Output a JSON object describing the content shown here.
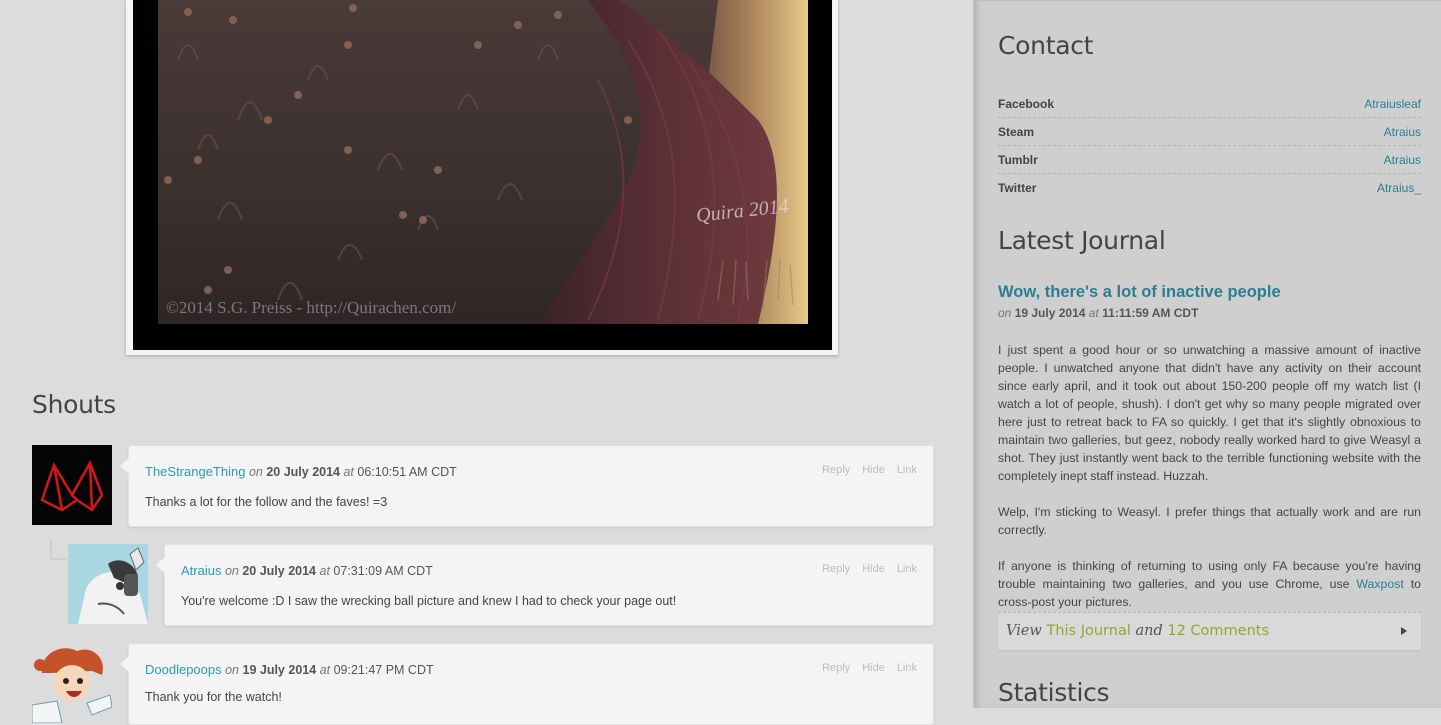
{
  "artwork": {
    "watermark": "©2014 S.G. Preiss - http://Quirachen.com/",
    "signature": "Quira 2014"
  },
  "shouts": {
    "title": "Shouts",
    "items": [
      {
        "user": "TheStrangeThing",
        "on_word": "on",
        "date": "20 July 2014",
        "at_word": "at",
        "time": "06:10:51 AM CDT",
        "message": "Thanks a lot for the follow and the faves! =3",
        "actions": [
          "Reply",
          "Hide",
          "Link"
        ],
        "avatar": "red-wire-shape-avatar"
      },
      {
        "user": "Atraius",
        "on_word": "on",
        "date": "20 July 2014",
        "at_word": "at",
        "time": "07:31:09 AM CDT",
        "message": "You're welcome :D I saw the wrecking ball picture and knew I had to check your page out!",
        "actions": [
          "Reply",
          "Hide",
          "Link"
        ],
        "avatar": "husky-character-avatar"
      },
      {
        "user": "Doodlepoops",
        "on_word": "on",
        "date": "19 July 2014",
        "at_word": "at",
        "time": "09:21:47 PM CDT",
        "message": "Thank you for the watch!",
        "actions": [
          "Reply",
          "Hide",
          "Link"
        ],
        "avatar": "cartoon-girl-avatar"
      }
    ]
  },
  "contact": {
    "title": "Contact",
    "rows": [
      {
        "label": "Facebook",
        "value": "Atraiusleaf"
      },
      {
        "label": "Steam",
        "value": "Atraius"
      },
      {
        "label": "Tumblr",
        "value": "Atraius"
      },
      {
        "label": "Twitter",
        "value": "Atraius_"
      }
    ]
  },
  "journal": {
    "title": "Latest Journal",
    "headline": "Wow, there's a lot of inactive people",
    "on_word": "on",
    "date": "19 July 2014",
    "at_word": "at",
    "time": "11:11:59 AM CDT",
    "p1": "I just spent a good hour or so unwatching a massive amount of inactive people. I unwatched anyone that didn't have any activity on their account since early april, and it took out about 150-200 people off my watch list (I watch a lot of people, shush). I don't get why so many people migrated over here just to retreat back to FA so quickly. I get that it's slightly obnoxious to maintain two galleries, but geez, nobody really worked hard to give Weasyl a shot. They just instantly went back to the terrible functioning website with the completely inept staff instead. Huzzah.",
    "p2": "Welp, I'm sticking to Weasyl. I prefer things that actually work and are run correctly.",
    "p3_before": "If anyone is thinking of returning to using only FA because you're having trouble maintaining two galleries, and you use Chrome, use ",
    "p3_link": "Waxpost",
    "p3_after": " to cross-post your pictures.",
    "view_prefix": "View",
    "view_link": "This Journal",
    "view_and": "and",
    "view_comments": "12 Comments"
  },
  "statistics": {
    "title": "Statistics"
  },
  "colors": {
    "link": "#2b7e92",
    "username": "#2b9bb0",
    "accent_green": "#8aab2e",
    "sidebar_bg": "#cfcfcf",
    "page_bg": "#dcdcdc"
  }
}
